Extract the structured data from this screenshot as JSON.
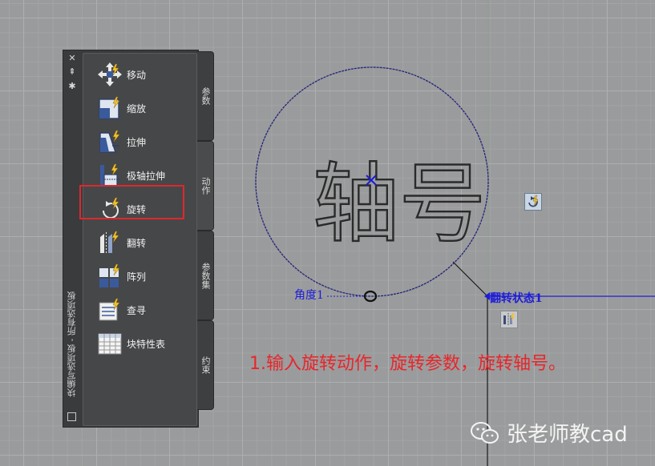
{
  "palette": {
    "title": "块编写选项板 - 所有选项板",
    "close_glyph": "✕",
    "autohide_glyph": "⇞",
    "properties_glyph": "✱",
    "tools": [
      {
        "label": "移动",
        "icon": "move-action-icon"
      },
      {
        "label": "缩放",
        "icon": "scale-action-icon"
      },
      {
        "label": "拉伸",
        "icon": "stretch-action-icon"
      },
      {
        "label": "极轴拉伸",
        "icon": "polar-stretch-action-icon"
      },
      {
        "label": "旋转",
        "icon": "rotate-action-icon"
      },
      {
        "label": "翻转",
        "icon": "flip-action-icon"
      },
      {
        "label": "阵列",
        "icon": "array-action-icon"
      },
      {
        "label": "查寻",
        "icon": "lookup-action-icon"
      },
      {
        "label": "块特性表",
        "icon": "block-table-icon"
      }
    ],
    "tabs": [
      {
        "label": "参数",
        "active": false
      },
      {
        "label": "动作",
        "active": true
      },
      {
        "label": "参数集",
        "active": false
      },
      {
        "label": "约束",
        "active": false
      }
    ]
  },
  "canvas": {
    "text_object": "轴号",
    "angle_param_label": "角度1",
    "flip_state_label": "翻转状态1",
    "accent_blue": "#1d1dd8",
    "highlight_color": "#e0262b"
  },
  "annotation": "1.输入旋转动作，旋转参数，旋转轴号。",
  "watermark": {
    "text": "张老师教cad",
    "icon": "wechat-icon"
  }
}
